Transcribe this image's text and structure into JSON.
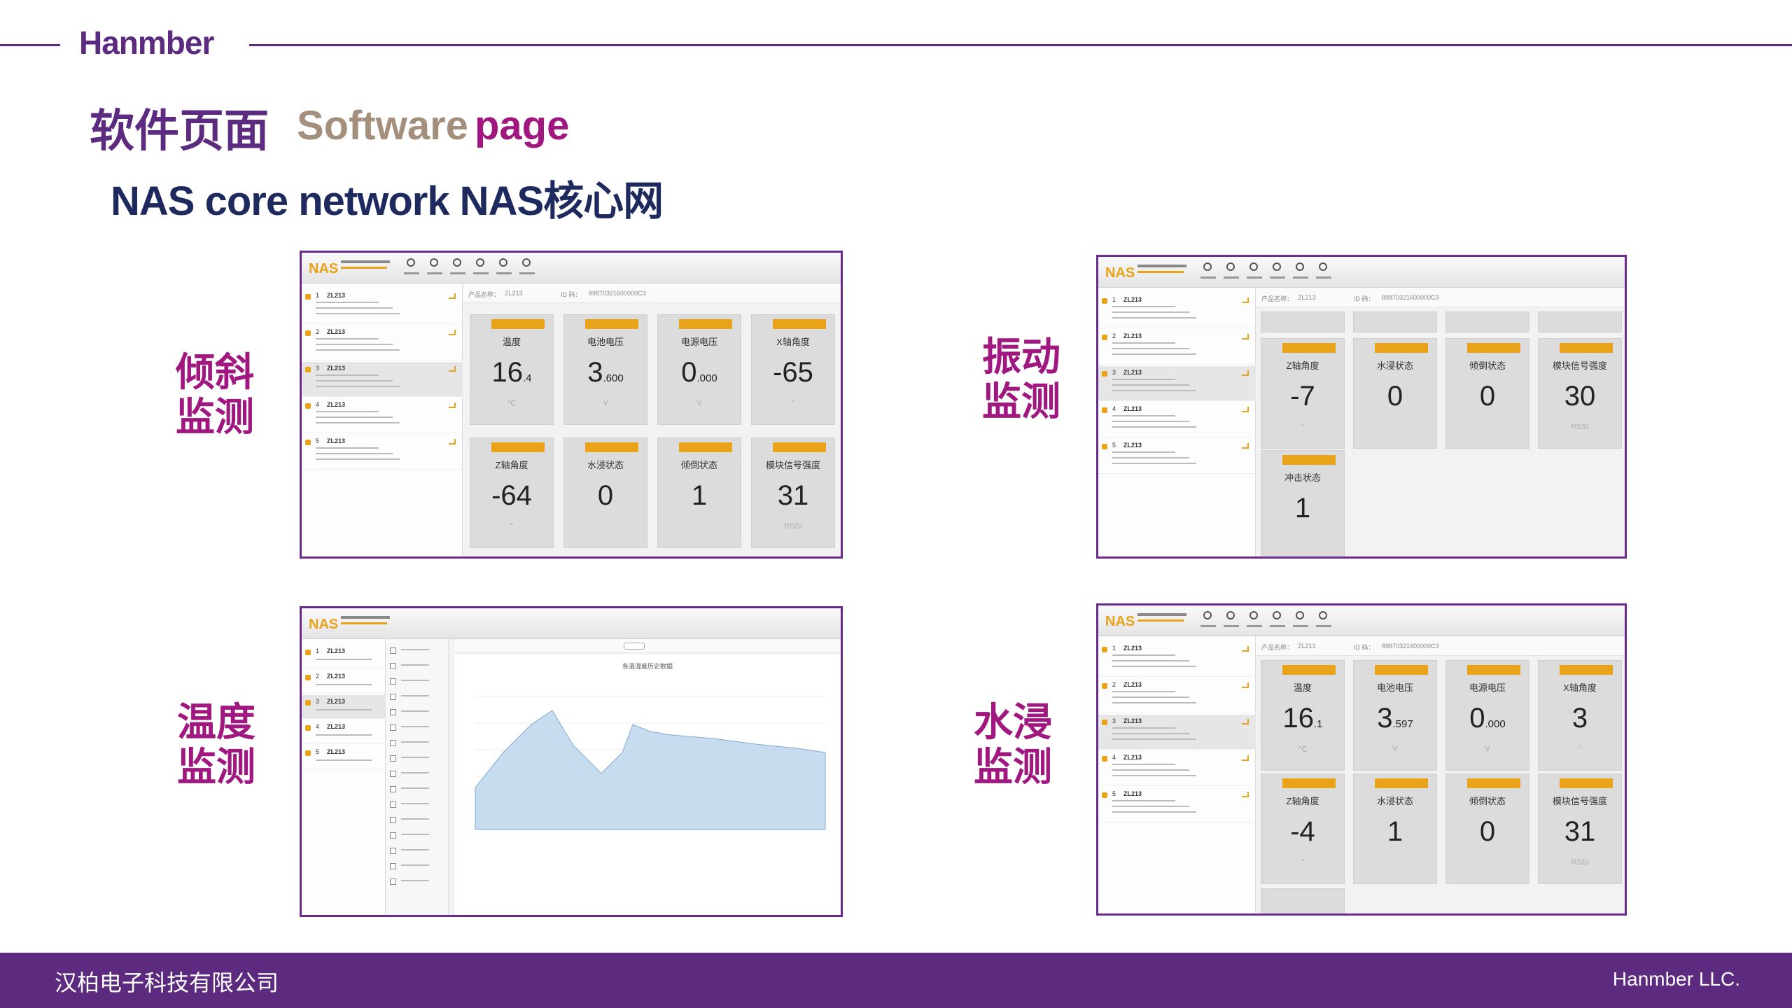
{
  "header": {
    "brand": "Hanmber",
    "title_cn": "软件页面",
    "title_en_part1": "Software",
    "title_en_part2": "page",
    "subtitle": "NAS core network  NAS核心网"
  },
  "labels": {
    "tilt": [
      "倾斜",
      "监测"
    ],
    "vibration": [
      "振动",
      "监测"
    ],
    "temperature": [
      "温度",
      "监测"
    ],
    "water": [
      "水浸",
      "监测"
    ]
  },
  "panel_common": {
    "logo": "NAS",
    "sidebar_items": [
      "ZL213",
      "ZL213",
      "ZL213",
      "ZL213",
      "ZL213"
    ],
    "product_label": "产品名称：",
    "product_value": "ZL213",
    "id_label": "ID 码：",
    "id_value": "89870321600000C3"
  },
  "tilt_panel": {
    "tiles": [
      {
        "label": "温度",
        "value": "16",
        "sub": ".4",
        "unit": "℃"
      },
      {
        "label": "电池电压",
        "value": "3",
        "sub": ".600",
        "unit": "V"
      },
      {
        "label": "电源电压",
        "value": "0",
        "sub": ".000",
        "unit": "V"
      },
      {
        "label": "X轴角度",
        "value": "-65",
        "sub": "",
        "unit": "°"
      },
      {
        "label": "Z轴角度",
        "value": "-64",
        "sub": "",
        "unit": "°"
      },
      {
        "label": "水浸状态",
        "value": "0",
        "sub": "",
        "unit": ""
      },
      {
        "label": "倾倒状态",
        "value": "1",
        "sub": "",
        "unit": ""
      },
      {
        "label": "模块信号强度",
        "value": "31",
        "sub": "",
        "unit": "RSSI"
      }
    ]
  },
  "vibration_panel": {
    "tiles": [
      {
        "label": "Z轴角度",
        "value": "-7",
        "sub": "",
        "unit": "°"
      },
      {
        "label": "水浸状态",
        "value": "0",
        "sub": "",
        "unit": ""
      },
      {
        "label": "倾倒状态",
        "value": "0",
        "sub": "",
        "unit": ""
      },
      {
        "label": "模块信号强度",
        "value": "30",
        "sub": "",
        "unit": "RSSI"
      },
      {
        "label": "冲击状态",
        "value": "1",
        "sub": "",
        "unit": ""
      }
    ]
  },
  "water_panel": {
    "tiles": [
      {
        "label": "温度",
        "value": "16",
        "sub": ".1",
        "unit": "℃"
      },
      {
        "label": "电池电压",
        "value": "3",
        "sub": ".597",
        "unit": "V"
      },
      {
        "label": "电源电压",
        "value": "0",
        "sub": ".000",
        "unit": "V"
      },
      {
        "label": "X轴角度",
        "value": "3",
        "sub": "",
        "unit": "°"
      },
      {
        "label": "Z轴角度",
        "value": "-4",
        "sub": "",
        "unit": "°"
      },
      {
        "label": "水浸状态",
        "value": "1",
        "sub": "",
        "unit": ""
      },
      {
        "label": "倾倒状态",
        "value": "0",
        "sub": "",
        "unit": ""
      },
      {
        "label": "模块信号强度",
        "value": "31",
        "sub": "",
        "unit": "RSSI"
      }
    ]
  },
  "temperature_panel": {
    "chart_title": "各温湿度历史数据",
    "series_color": "#b9d3ea"
  },
  "footer": {
    "company_cn": "汉柏电子科技有限公司",
    "company_en": "Hanmber LLC."
  },
  "colors": {
    "brand_purple": "#5c2a7e",
    "magenta": "#a0177f",
    "tag_orange": "#e8a31a"
  }
}
